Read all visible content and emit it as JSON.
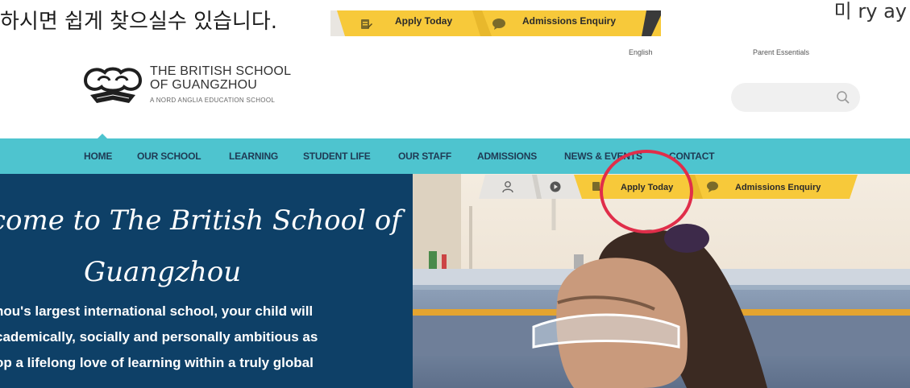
{
  "caption": {
    "text": "하시면 쉽게 찾으실수 있습니다.",
    "right_fragment": "미 ry ay"
  },
  "small_cta": {
    "apply_label": "Apply Today",
    "enquiry_label": "Admissions Enquiry"
  },
  "header": {
    "logo_line1": "THE BRITISH SCHOOL",
    "logo_line2": "OF GUANGZHOU",
    "logo_tagline": "A NORD ANGLIA EDUCATION SCHOOL",
    "language": "English",
    "parent_essentials": "Parent Essentials",
    "search_placeholder": ""
  },
  "nav": {
    "items": [
      {
        "label": "HOME"
      },
      {
        "label": "OUR SCHOOL"
      },
      {
        "label": "LEARNING"
      },
      {
        "label": "STUDENT LIFE"
      },
      {
        "label": "OUR STAFF"
      },
      {
        "label": "ADMISSIONS"
      },
      {
        "label": "NEWS & EVENTS"
      },
      {
        "label": "CONTACT"
      }
    ]
  },
  "hero": {
    "title_line1": "come to The British School of",
    "title_line2": "Guangzhou",
    "body_lines": [
      "hou's largest international school, your child will",
      "cademically, socially and personally ambitious as",
      "op a lifelong love of learning within a truly global"
    ]
  },
  "cta_bar": {
    "apply_label": "Apply Today",
    "enquiry_label": "Admissions Enquiry"
  },
  "colors": {
    "nav_bg": "#4ec4cf",
    "hero_bg": "#0e4067",
    "cta_yellow": "#f7c93a",
    "cta_grey": "#e6e4e1",
    "ring": "#e02e4a"
  }
}
